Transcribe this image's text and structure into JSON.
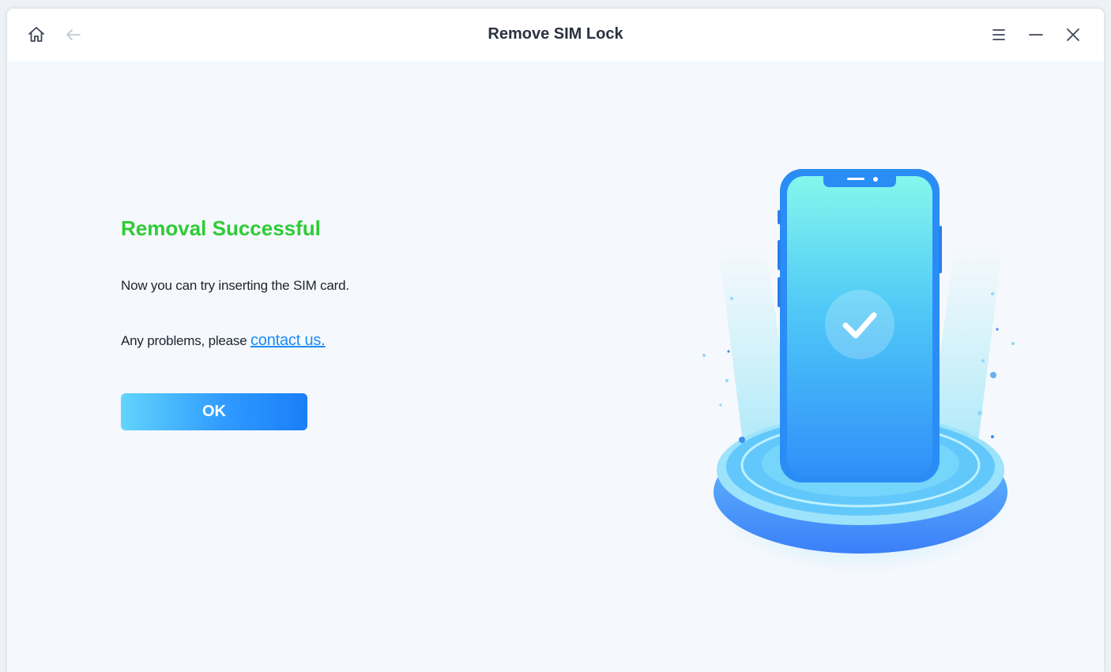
{
  "window": {
    "title": "Remove SIM Lock",
    "toolbar_icons": [
      "home-icon",
      "back-arrow-icon",
      "menu-icon",
      "minimize-icon",
      "close-icon"
    ]
  },
  "content": {
    "heading": "Removal Successful",
    "message": "Now you can try inserting the SIM card.",
    "help_prefix": "Any problems, please ",
    "help_link": "contact us.",
    "ok_label": "OK"
  },
  "colors": {
    "heading_green": "#2ecb36",
    "link_blue": "#1b8cf5",
    "button_start": "#62d4fb",
    "button_end": "#1a7ef7"
  },
  "illustration": {
    "icon": "phone-with-checkmark-on-pedestal-icon"
  }
}
